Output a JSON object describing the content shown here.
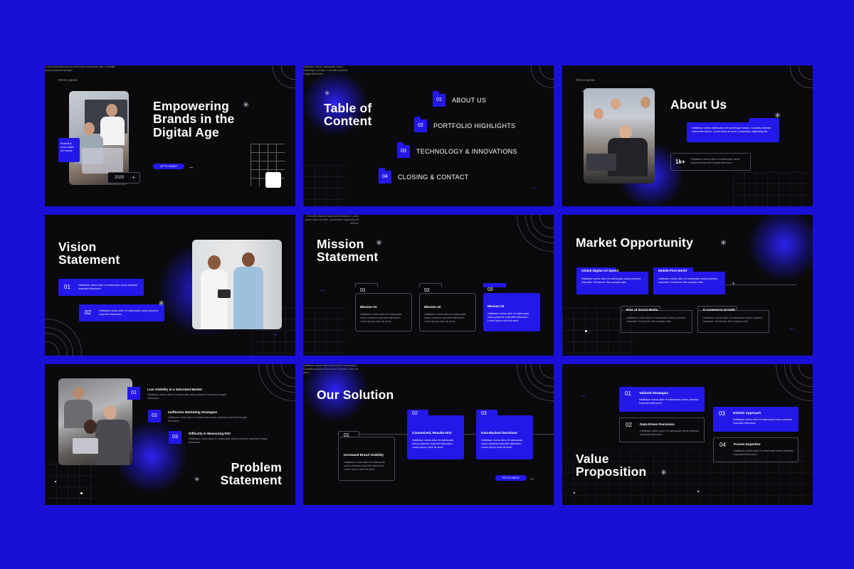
{
  "colors": {
    "background": "#1a0fd6",
    "slide_bg": "#0a0a0d",
    "accent": "#2318e8"
  },
  "lorem_short": "Habitasse varius dolor et malesuada varius pharetra imperdiet feugiat bibendum.",
  "slide1": {
    "kicker": "PITCH DECK",
    "title": "Empowering Brands in the Digital Age",
    "body": "Lorem parturient sed sit amet tortor consequat nulla. Convallis dictum pharetra quisque.",
    "badge": "Phasellus proin mattis est mauris",
    "year": "2025",
    "cta": "LET'S START"
  },
  "slide2": {
    "title": "Table of Content",
    "body": "Habitasse varius malesuada varius scelerisque ultricies. Convallis pharetra feugiat bibendum.",
    "items": [
      {
        "num": "01",
        "label": "ABOUT US"
      },
      {
        "num": "02",
        "label": "PORTFOLIO HIGHLIGHTS"
      },
      {
        "num": "03",
        "label": "TECHNOLOGY & INNOVATIONS"
      },
      {
        "num": "04",
        "label": "CLOSING & CONTACT"
      }
    ]
  },
  "slide3": {
    "kicker": "PITCH DECK",
    "title": "About Us",
    "card_text": "Habitasse varius malesuada vel scelerisque luctus. Convallis pharetra maecenas dictum. Lorem dolor sit amet, consectetur adipiscing elit.",
    "stat": "1k+",
    "stat_text": "Habitasse varius dolor et malesuada varius pharetra imperdiet feugiat bibendum."
  },
  "slide4": {
    "title": "Vision Statement",
    "items": [
      {
        "num": "01",
        "text": "Habitasse varius dolor et malesuada varius pharetra imperdiet bibendum."
      },
      {
        "num": "02",
        "text": "Habitasse varius dolor et malesuada varius pharetra imperdiet bibendum."
      }
    ]
  },
  "slide5": {
    "title": "Mission Statement",
    "body": "Convallis pharetra imperdiet bibendum. Lorem ipsum dolor sit amet, consectetur adipiscing elit sed do.",
    "cards": [
      {
        "num": "01",
        "title": "Mission 01",
        "text": "Habitasse varius dolor et malesuada varius pharetra imperdiet bibendum. Lorem ipsum dolor sit amet."
      },
      {
        "num": "02",
        "title": "Mission 02",
        "text": "Habitasse varius dolor et malesuada varius pharetra imperdiet bibendum. Lorem ipsum dolor sit amet."
      },
      {
        "num": "03",
        "title": "Mission 03",
        "text": "Habitasse varius dolor et malesuada varius pharetra imperdiet bibendum. Lorem ipsum dolor sit amet."
      }
    ]
  },
  "slide6": {
    "title": "Market Opportunity",
    "cards": [
      {
        "title": "Global Digital Ad Spend",
        "text": "Habitasse varius dolor et malesuada varius pharetra imperdiet. Vit fastura. Nisi suscipit nulla."
      },
      {
        "title": "Mobile-First World",
        "text": "Habitasse varius dolor et malesuada varius pharetra imperdiet. Vit fastura. Nisi suscipit nulla."
      },
      {
        "title": "Rise of Social Media",
        "text": "Habitasse varius dolor et malesuada varius pharetra imperdiet. Vit fastura. Nisi suscipit nulla."
      },
      {
        "title": "E-commerce Growth",
        "text": "Habitasse varius dolor et malesuada varius pharetra imperdiet. Vit fastura. Nisi suscipit nulla."
      }
    ]
  },
  "slide7": {
    "title": "Problem Statement",
    "items": [
      {
        "num": "01",
        "title": "Low Visibility in a Saturated Market",
        "text": "Habitasse varius dolor et malesuada varius pharetra imperdiet feugiat bibendum."
      },
      {
        "num": "02",
        "title": "Ineffective Marketing Strategies",
        "text": "Habitasse varius dolor et malesuada varius pharetra imperdiet feugiat bibendum."
      },
      {
        "num": "03",
        "title": "Difficulty in Measuring ROI",
        "text": "Habitasse varius dolor et malesuada varius pharetra imperdiet feugiat bibendum."
      }
    ]
  },
  "slide8": {
    "title": "Our Solution",
    "body": "Habitasse varius malesuada varius scelerisque. Convallis pharetra maecenas bibendum dolor sit amet.",
    "cards": [
      {
        "num": "01",
        "title": "Increased Brand Visibility",
        "text": "Habitasse varius dolor et malesuada varius pharetra imperdiet bibendum. Lorem ipsum dolor sit amet."
      },
      {
        "num": "02",
        "title": "Customized, Results-Driv",
        "text": "Habitasse varius dolor et malesuada varius pharetra imperdiet bibendum. Lorem ipsum dolor sit amet."
      },
      {
        "num": "03",
        "title": "Data-Backed Decisions",
        "text": "Habitasse varius dolor et malesuada varius pharetra imperdiet bibendum. Lorem ipsum dolor sit amet."
      }
    ],
    "pill": "PITCH DECK"
  },
  "slide9": {
    "title": "Value Proposition",
    "items": [
      {
        "num": "01",
        "title": "Tailored Strategies",
        "text": "Habitasse varius dolor et malesuada varius pharetra imperdiet bibendum."
      },
      {
        "num": "02",
        "title": "Data-Driven Decisions",
        "text": "Habitasse varius dolor et malesuada varius pharetra imperdiet bibendum."
      },
      {
        "num": "03",
        "title": "Holistic Approach",
        "text": "Habitasse varius dolor et malesuada varius pharetra imperdiet bibendum."
      },
      {
        "num": "04",
        "title": "Proven Expertise",
        "text": "Habitasse varius dolor et malesuada varius pharetra imperdiet bibendum."
      }
    ]
  }
}
